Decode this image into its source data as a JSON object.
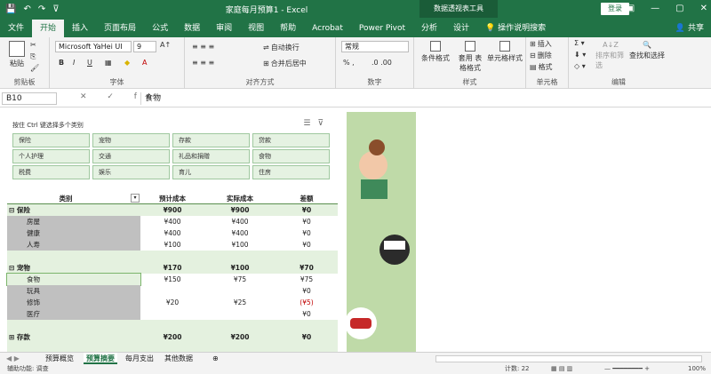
{
  "titlebar": {
    "save": "💾",
    "undo": "↶",
    "redo": "↷",
    "qa_menu": "⊽",
    "title": "家庭每月预算1  -  Excel",
    "context_tool": "数据透视表工具",
    "login": "登录",
    "win_ribbon": "▣",
    "win_min": "—",
    "win_max": "▢",
    "win_close": "✕"
  },
  "ribbon_tabs": [
    "文件",
    "开始",
    "插入",
    "页面布局",
    "公式",
    "数据",
    "审阅",
    "视图",
    "帮助",
    "Acrobat",
    "Power Pivot",
    "分析",
    "设计"
  ],
  "tell_me": "操作说明搜索",
  "share": "共享",
  "ribbon": {
    "paste": "粘贴",
    "clipboard": "剪贴板",
    "font_name": "Microsoft YaHei UI",
    "font_size": "9",
    "bold": "B",
    "italic": "I",
    "underline": "U",
    "font_group": "字体",
    "wrap": "自动换行",
    "merge": "合并后居中",
    "align_group": "对齐方式",
    "number_format": "常规",
    "number_group": "数字",
    "cond_format": "条件格式",
    "table_format": "套用\n表格格式",
    "cell_style": "单元格样式",
    "style_group": "样式",
    "insert": "插入",
    "delete": "删除",
    "format": "格式",
    "cells_group": "单元格",
    "sort_filter": "排序和筛选",
    "find_select": "查找和选择",
    "edit_group": "编辑"
  },
  "formula": {
    "name_box": "B10",
    "fx": "✕ ✓ fx",
    "content": "食物"
  },
  "slicer": {
    "title": "按住 Ctrl 键选择多个类别",
    "items": [
      "保险",
      "宠物",
      "存款",
      "贷款",
      "个人护理",
      "交通",
      "礼品和捐赠",
      "食物",
      "税费",
      "娱乐",
      "育儿",
      "住房"
    ]
  },
  "table": {
    "headers": [
      "类别",
      "预计成本",
      "实际成本",
      "差额"
    ],
    "rows": [
      {
        "cat": "⊟ 保险",
        "b": "¥900",
        "a": "¥900",
        "d": "¥0",
        "type": "group"
      },
      {
        "cat": "房屋",
        "b": "¥400",
        "a": "¥400",
        "d": "¥0",
        "type": "item"
      },
      {
        "cat": "健康",
        "b": "¥400",
        "a": "¥400",
        "d": "¥0",
        "type": "item"
      },
      {
        "cat": "人寿",
        "b": "¥100",
        "a": "¥100",
        "d": "¥0",
        "type": "item"
      },
      {
        "cat": "",
        "b": "",
        "a": "",
        "d": "",
        "type": "blank"
      },
      {
        "cat": "⊟ 宠物",
        "b": "¥170",
        "a": "¥100",
        "d": "¥70",
        "type": "group"
      },
      {
        "cat": "食物",
        "b": "¥150",
        "a": "¥75",
        "d": "¥75",
        "type": "sel"
      },
      {
        "cat": "玩具",
        "b": "",
        "a": "",
        "d": "¥0",
        "type": "item"
      },
      {
        "cat": "修饰",
        "b": "¥20",
        "a": "¥25",
        "d": "(¥5)",
        "type": "item"
      },
      {
        "cat": "医疗",
        "b": "",
        "a": "",
        "d": "¥0",
        "type": "item"
      },
      {
        "cat": "",
        "b": "",
        "a": "",
        "d": "",
        "type": "blank"
      },
      {
        "cat": "⊞ 存款",
        "b": "¥200",
        "a": "¥200",
        "d": "¥0",
        "type": "group"
      },
      {
        "cat": "",
        "b": "",
        "a": "",
        "d": "",
        "type": "blank"
      },
      {
        "cat": "⊞ 贷款",
        "b": "¥200",
        "a": "¥200",
        "d": "¥0",
        "type": "group"
      }
    ]
  },
  "sheet_tabs": [
    "预算概览",
    "预算摘要",
    "每月支出",
    "其他数据"
  ],
  "add_sheet": "⊕",
  "status": {
    "mode": "辅助功能: 调查",
    "count": "计数: 22",
    "zoom": "100%"
  },
  "colors": {
    "accent": "#217346",
    "band": "#e4f1df",
    "negative": "#c00000",
    "green_panel": "#bfdaa8"
  }
}
